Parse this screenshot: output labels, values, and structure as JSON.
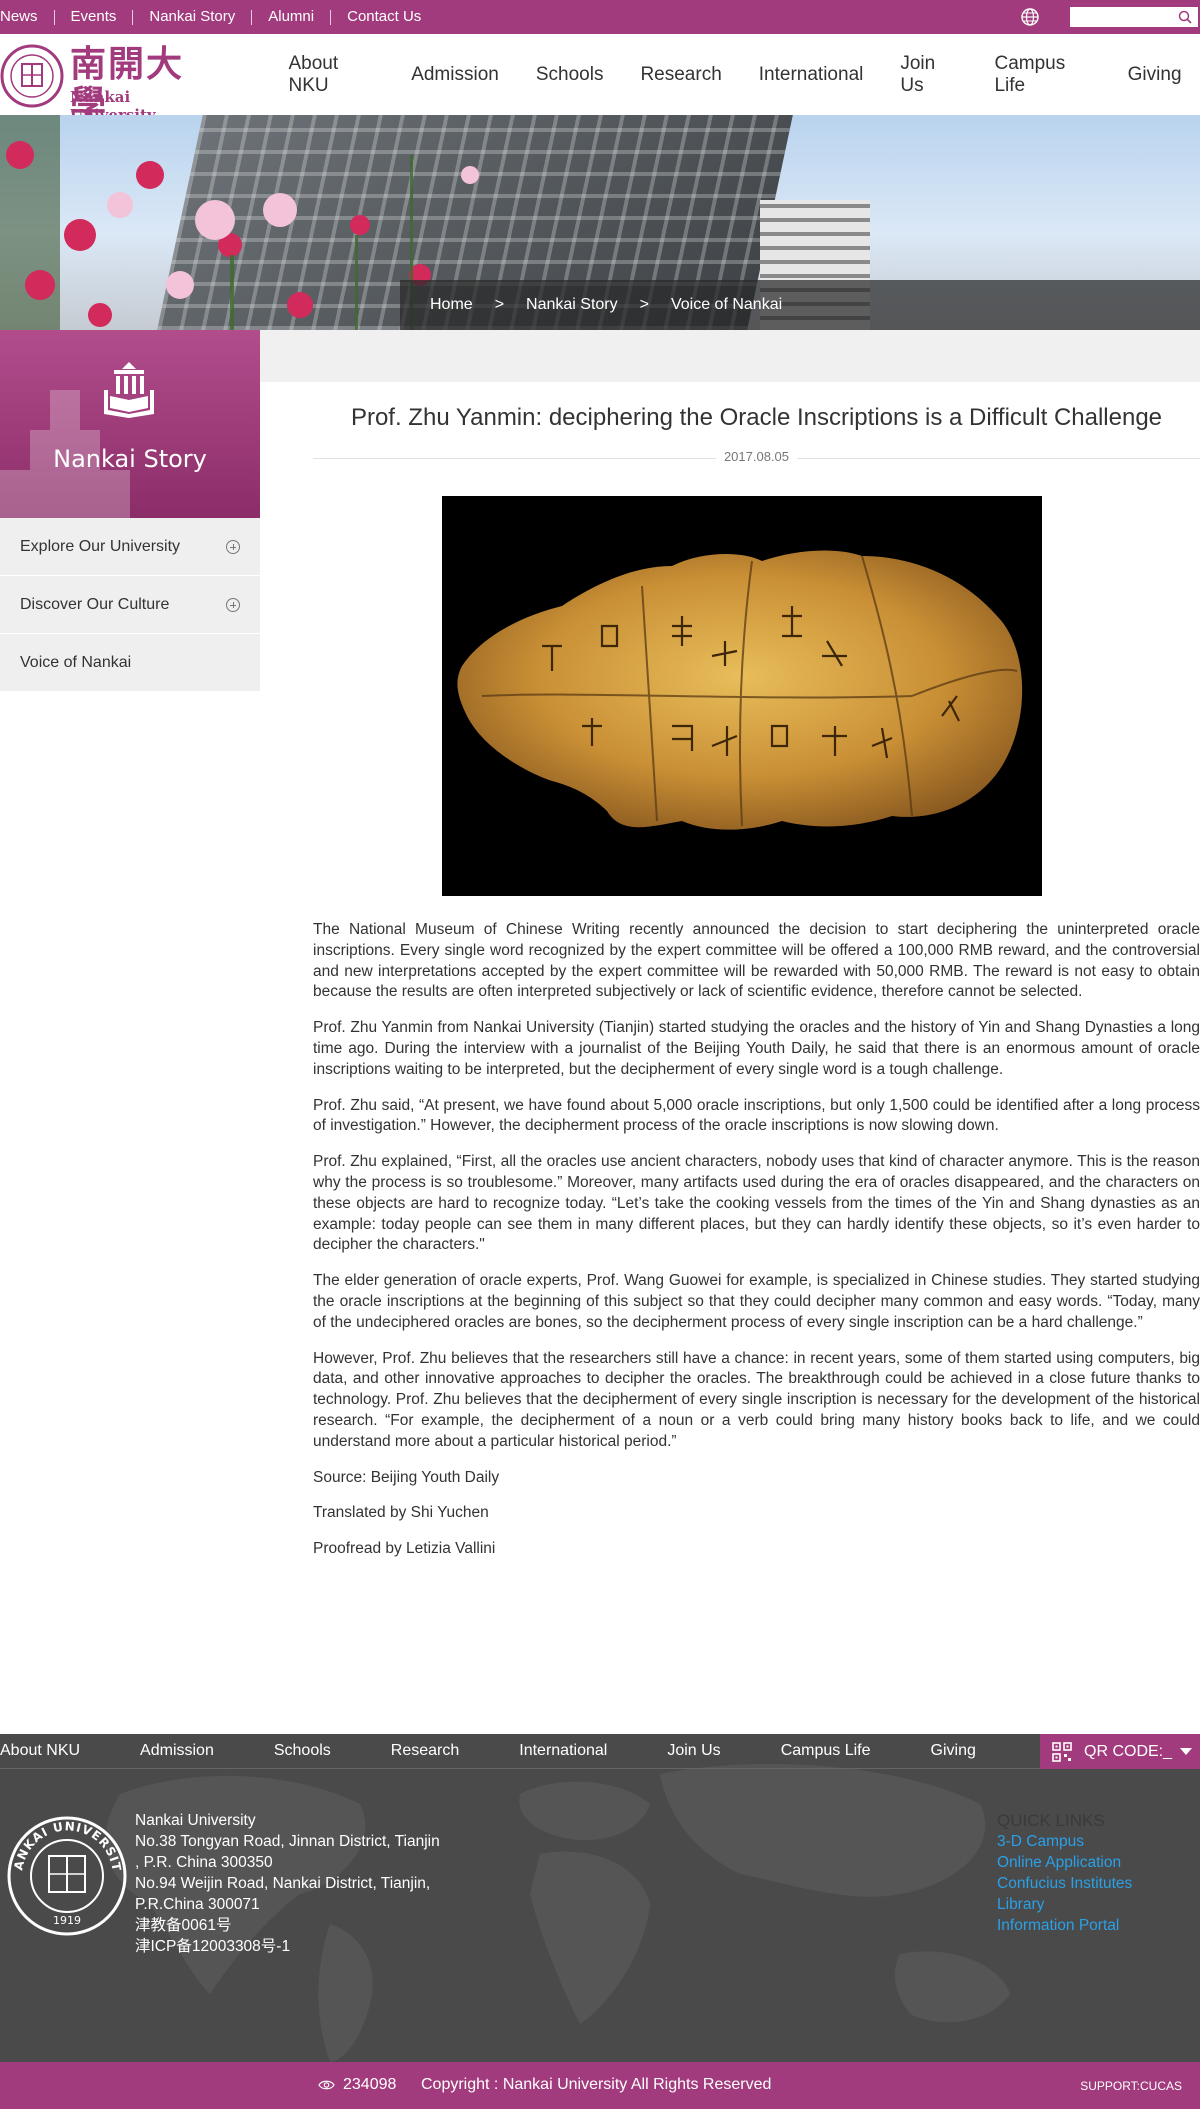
{
  "topbar": {
    "links": [
      "News",
      "Events",
      "Nankai Story",
      "Alumni",
      "Contact Us"
    ],
    "search_placeholder": ""
  },
  "header": {
    "logo_cn": "南開大學",
    "logo_en": "Nankai University",
    "nav": [
      "About NKU",
      "Admission",
      "Schools",
      "Research",
      "International",
      "Join Us",
      "Campus Life",
      "Giving"
    ]
  },
  "breadcrumb": [
    "Home",
    "Nankai Story",
    "Voice of Nankai"
  ],
  "breadcrumb_sep": ">",
  "sidebar": {
    "title": "Nankai Story",
    "items": [
      {
        "label": "Explore Our University",
        "expandable": true
      },
      {
        "label": "Discover Our Culture",
        "expandable": true
      },
      {
        "label": "Voice of Nankai",
        "expandable": false
      }
    ]
  },
  "article": {
    "title": "Prof. Zhu Yanmin: deciphering the Oracle Inscriptions is a Difficult Challenge",
    "date": "2017.08.05",
    "paragraphs": [
      "The National Museum of Chinese Writing recently announced the decision to start deciphering the uninterpreted oracle inscriptions. Every single word recognized by the expert committee will be offered a 100,000 RMB reward, and the controversial and new interpretations accepted by the expert committee will be rewarded with 50,000 RMB. The reward is not easy to obtain because the results are often interpreted subjectively or lack of scientific evidence, therefore cannot be selected.",
      "Prof. Zhu Yanmin from Nankai University (Tianjin) started studying the oracles and the history of Yin and Shang Dynasties a long time ago. During the interview with a journalist of the Beijing Youth Daily, he said that there is an enormous amount of oracle inscriptions waiting to be interpreted, but the decipherment of every single word is a tough challenge.",
      "Prof. Zhu said, “At present, we have found about 5,000 oracle inscriptions, but only 1,500 could be identified after a long process of investigation.” However, the decipherment process of the oracle inscriptions is now slowing down.",
      "Prof. Zhu explained, “First, all the oracles use ancient characters, nobody uses that kind of character anymore. This is the reason why the process is so troublesome.” Moreover, many artifacts used during the era of oracles disappeared, and the characters on these objects are hard to recognize today. “Let’s take the cooking vessels from the times of the Yin and Shang dynasties as an example: today people can see them in many different places, but they can hardly identify these objects, so it’s even harder to decipher the characters.\"",
      "The elder generation of oracle experts, Prof. Wang Guowei for example, is specialized in Chinese studies. They started studying the oracle inscriptions at the beginning of this subject so that they could decipher many common and easy words. “Today, many of the undeciphered oracles are bones, so the decipherment process of every single inscription can be a hard challenge.”",
      "However, Prof. Zhu believes that the researchers still have a chance: in recent years, some of them started using computers, big data, and other innovative approaches to decipher the oracles. The breakthrough could be achieved in a close future thanks to technology. Prof. Zhu believes that the decipherment of every single inscription is necessary for the development of the historical research. “For example, the decipherment of a noun or a verb could bring many history books back to life, and we could understand more about a particular historical period.”",
      "Source: Beijing Youth Daily",
      "Translated by Shi Yuchen",
      "Proofread by Letizia Vallini"
    ]
  },
  "footer": {
    "nav": [
      "About NKU",
      "Admission",
      "Schools",
      "Research",
      "International",
      "Join Us",
      "Campus Life",
      "Giving"
    ],
    "qr_label": "QR CODE:_",
    "seal_text": "NANKAI UNIVERSITY",
    "seal_year": "1919",
    "address_lines": [
      "Nankai University",
      "No.38 Tongyan Road, Jinnan District, Tianjin",
      ", P.R. China 300350",
      "No.94 Weijin Road,  Nankai District, Tianjin,",
      "P.R.China  300071",
      "津教备0061号",
      "津ICP备12003308号-1"
    ],
    "quick_links_title": "QUICK LINKS",
    "quick_links": [
      "3-D Campus",
      "Online Application",
      "Confucius Institutes",
      "Library",
      "Information Portal"
    ]
  },
  "bottombar": {
    "visits": "234098",
    "copyright": "Copyright : Nankai University All Rights Reserved",
    "support": "SUPPORT:CUCAS"
  },
  "colors": {
    "brand": "#a23b7d",
    "link": "#2aa0e6",
    "footer_bg": "#4a4a4a"
  }
}
